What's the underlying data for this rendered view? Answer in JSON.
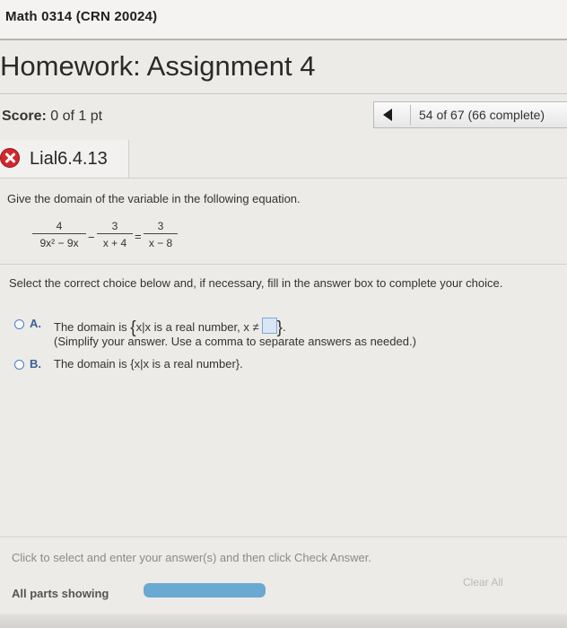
{
  "course": {
    "title": "Math 0314 (CRN 20024)"
  },
  "homework": {
    "title": "Homework: Assignment 4"
  },
  "score": {
    "label": "Score:",
    "value": "0 of 1 pt"
  },
  "navigation": {
    "position_text": "54 of 67 (66 complete)",
    "prev_icon": "triangle-left-icon"
  },
  "question": {
    "status_icon": "incorrect-x-icon",
    "id": "Lial6.4.13",
    "prompt": "Give the domain of the variable in the following equation.",
    "equation": {
      "term1": {
        "num": "4",
        "den": "9x² − 9x"
      },
      "op1": "−",
      "term2": {
        "num": "3",
        "den": "x + 4"
      },
      "op2": "=",
      "term3": {
        "num": "3",
        "den": "x − 8"
      }
    },
    "instruction": "Select the correct choice below and, if necessary, fill in the answer box to complete your choice."
  },
  "choices": [
    {
      "letter": "A.",
      "text_before": "The domain is ",
      "brace_open": "{",
      "set_text": "x|x is a real number, x ≠",
      "brace_close": "}",
      "text_after": ".",
      "hint": "(Simplify your answer. Use a comma to separate answers as needed.)"
    },
    {
      "letter": "B.",
      "text": "The domain is {x|x is a real number}."
    }
  ],
  "footer": {
    "hint": "Click to select and enter your answer(s) and then click Check Answer.",
    "parts_label": "All parts showing",
    "progress": 1.0,
    "clear_label": "Clear All"
  },
  "colors": {
    "incorrect_red": "#d3272d",
    "accent_blue": "#4a7fc1",
    "progress_blue": "#6aa9d1"
  }
}
